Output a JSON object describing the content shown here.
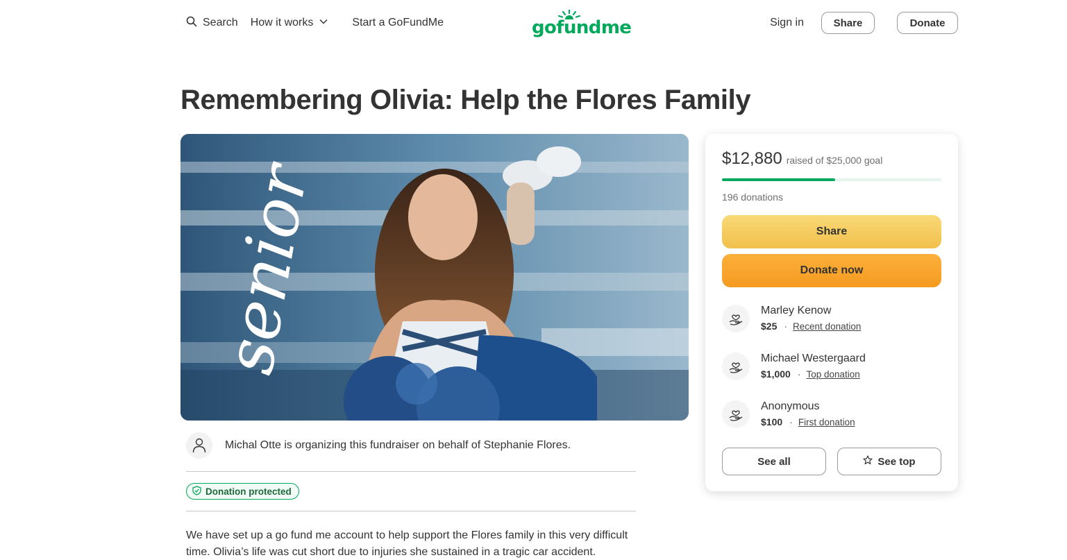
{
  "header": {
    "search_label": "Search",
    "how_it_works_label": "How it works",
    "start_label": "Start a GoFundMe",
    "logo_text": "gofundme",
    "sign_in_label": "Sign in",
    "share_label": "Share",
    "donate_label": "Donate"
  },
  "campaign": {
    "title": "Remembering Olivia: Help the Flores Family",
    "hero_text": "senior",
    "organizer_text": "Michal Otte is organizing this fundraiser on behalf of Stephanie Flores.",
    "protected_label": "Donation protected",
    "story": "We have set up a go fund me account to help support the Flores family in this very difficult time. Olivia’s life was cut short due to injuries she sustained in a tragic car accident."
  },
  "donation_card": {
    "raised_amount": "$12,880",
    "raised_goal_text": "raised of $25,000 goal",
    "progress_fraction": 0.5152,
    "donation_count": "196 donations",
    "share_label": "Share",
    "donate_now_label": "Donate now",
    "donors": [
      {
        "name": "Marley Kenow",
        "amount": "$25",
        "tag": "Recent donation"
      },
      {
        "name": "Michael Westergaard",
        "amount": "$1,000",
        "tag": "Top donation"
      },
      {
        "name": "Anonymous",
        "amount": "$100",
        "tag": "First donation"
      }
    ],
    "see_all_label": "See all",
    "see_top_label": "See top"
  },
  "colors": {
    "brand_green": "#02a95c",
    "share_yellow": "#f2c04d",
    "donate_orange": "#f59a20"
  },
  "icons": [
    "search-icon",
    "chevron-down-icon",
    "sun-logo-icon",
    "person-icon",
    "shield-check-icon",
    "heart-hand-icon",
    "star-icon"
  ]
}
